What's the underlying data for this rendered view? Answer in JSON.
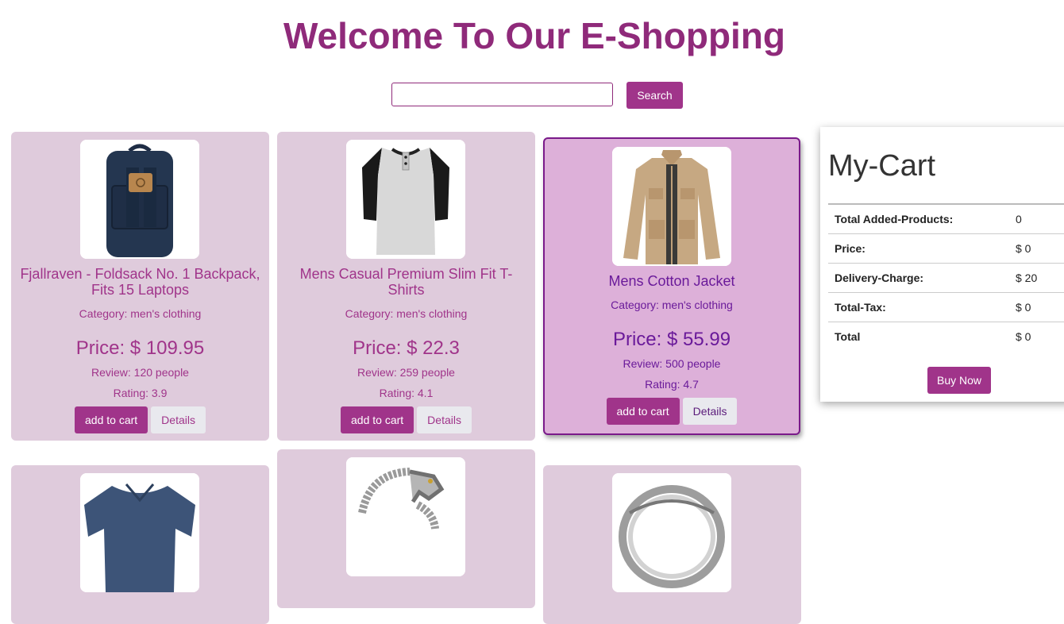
{
  "header": {
    "title": "Welcome To Our E-Shopping"
  },
  "search": {
    "placeholder": "",
    "value": "",
    "button_label": "Search"
  },
  "products": [
    {
      "name": "Fjallraven - Foldsack No. 1 Backpack, Fits 15 Laptops",
      "category": "Category: men's clothing",
      "price": "Price: $ 109.95",
      "review": "Review: 120 people",
      "rating": "Rating: 3.9",
      "add_label": "add to cart",
      "details_label": "Details",
      "image_icon": "backpack-icon"
    },
    {
      "name": "Mens Casual Premium Slim Fit T-Shirts",
      "category": "Category: men's clothing",
      "price": "Price: $ 22.3",
      "review": "Review: 259 people",
      "rating": "Rating: 4.1",
      "add_label": "add to cart",
      "details_label": "Details",
      "image_icon": "tshirt-icon"
    },
    {
      "name": "Mens Cotton Jacket",
      "category": "Category: men's clothing",
      "price": "Price: $ 55.99",
      "review": "Review: 500 people",
      "rating": "Rating: 4.7",
      "add_label": "add to cart",
      "details_label": "Details",
      "image_icon": "jacket-icon"
    }
  ],
  "more_products": [
    {
      "image_icon": "shirt-icon"
    },
    {
      "image_icon": "bracelet-icon"
    },
    {
      "image_icon": "ring-icon"
    }
  ],
  "cart": {
    "title": "My-Cart",
    "rows": [
      {
        "label": "Total Added-Products:",
        "value": "0"
      },
      {
        "label": "Price:",
        "value": "$ 0"
      },
      {
        "label": "Delivery-Charge:",
        "value": "$ 20"
      },
      {
        "label": "Total-Tax:",
        "value": "$ 0"
      },
      {
        "label": "Total",
        "value": "$ 0"
      }
    ],
    "buy_label": "Buy Now"
  },
  "colors": {
    "accent": "#a0348a",
    "title": "#8f2a7a",
    "card_bg": "#dfcbdc",
    "card_active_bg": "#ddb0d9"
  }
}
